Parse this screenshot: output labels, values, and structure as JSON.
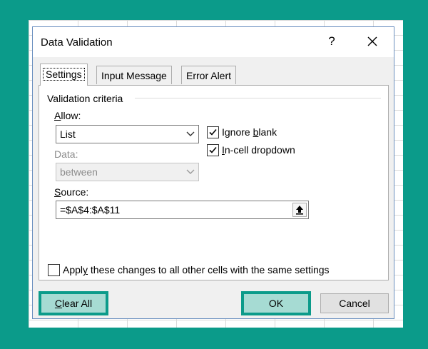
{
  "dialog": {
    "title": "Data Validation",
    "help_label": "?",
    "close_icon": "close-icon"
  },
  "tabs": [
    {
      "label": "Settings",
      "active": true
    },
    {
      "label": "Input Message",
      "active": false
    },
    {
      "label": "Error Alert",
      "active": false
    }
  ],
  "criteria": {
    "group_label": "Validation criteria",
    "allow_label_pre": "A",
    "allow_label_rest": "llow:",
    "allow_value": "List",
    "data_label": "Data:",
    "data_value": "between",
    "source_label_pre": "S",
    "source_label_rest": "ource:",
    "source_value": "=$A$4:$A$11",
    "ignore_blank_pre": "Ignore ",
    "ignore_blank_accel": "b",
    "ignore_blank_rest": "lank",
    "ignore_blank_checked": true,
    "incell_accel": "I",
    "incell_rest": "n-cell dropdown",
    "incell_checked": true
  },
  "apply_all": {
    "pre": "Appl",
    "accel": "y",
    "rest": " these changes to all other cells with the same settings",
    "checked": false
  },
  "buttons": {
    "clear_accel": "C",
    "clear_rest": "lear All",
    "ok": "OK",
    "cancel": "Cancel"
  },
  "colors": {
    "background_frame": "#0b9b8a",
    "highlight_fill": "#a6dbd3"
  }
}
